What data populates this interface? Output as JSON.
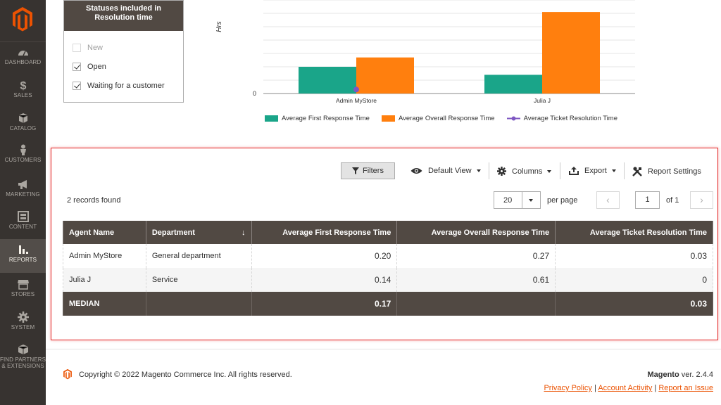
{
  "sidebar": {
    "items": [
      {
        "label": "DASHBOARD",
        "icon": "dashboard-icon"
      },
      {
        "label": "SALES",
        "icon": "dollar-icon"
      },
      {
        "label": "CATALOG",
        "icon": "cube-icon"
      },
      {
        "label": "CUSTOMERS",
        "icon": "person-icon"
      },
      {
        "label": "MARKETING",
        "icon": "megaphone-icon"
      },
      {
        "label": "CONTENT",
        "icon": "content-icon"
      },
      {
        "label": "REPORTS",
        "icon": "bar-chart-icon"
      },
      {
        "label": "STORES",
        "icon": "store-icon"
      },
      {
        "label": "SYSTEM",
        "icon": "gear-icon"
      },
      {
        "label": "FIND PARTNERS",
        "label2": "& EXTENSIONS",
        "icon": "box-icon"
      }
    ]
  },
  "statuses": {
    "title_line1": "Statuses included in",
    "title_line2": "Resolution time",
    "items": [
      {
        "label": "New",
        "checked": false,
        "disabled": true
      },
      {
        "label": "Open",
        "checked": true,
        "disabled": false
      },
      {
        "label": "Waiting for a customer",
        "checked": true,
        "disabled": false
      }
    ]
  },
  "chart_data": {
    "type": "bar",
    "ylabel": "Hrs",
    "ytick_zero": "0",
    "categories": [
      "Admin MyStore",
      "Julia J"
    ],
    "series": [
      {
        "name": "Average First Response Time",
        "color": "#1aa589",
        "values": [
          0.2,
          0.14
        ]
      },
      {
        "name": "Average Overall Response Time",
        "color": "#ff7f0e",
        "values": [
          0.27,
          0.61
        ]
      },
      {
        "name": "Average Ticket Resolution Time",
        "color": "#7e57c2",
        "values": [
          0.03,
          0
        ]
      }
    ],
    "ylim": [
      0,
      0.7
    ]
  },
  "toolbar": {
    "filters": "Filters",
    "view": "Default View",
    "columns": "Columns",
    "export": "Export",
    "settings": "Report Settings"
  },
  "grid": {
    "records_found": "2 records found",
    "per_page_value": "20",
    "per_page_label": "per page",
    "page_value": "1",
    "page_of": "of 1",
    "columns": [
      "Agent Name",
      "Department",
      "Average First Response Time",
      "Average Overall Response Time",
      "Average Ticket Resolution Time"
    ],
    "rows": [
      [
        "Admin MyStore",
        "General department",
        "0.20",
        "0.27",
        "0.03"
      ],
      [
        "Julia J",
        "Service",
        "0.14",
        "0.61",
        "0"
      ]
    ],
    "footer": [
      "MEDIAN",
      "",
      "0.17",
      "",
      "0.03"
    ]
  },
  "footer": {
    "copyright": "Copyright © 2022 Magento Commerce Inc. All rights reserved.",
    "brand": "Magento",
    "version": " ver. 2.4.4",
    "privacy": "Privacy Policy",
    "sep1": " | ",
    "activity": "Account Activity",
    "sep2": " | ",
    "issue": "Report an Issue"
  },
  "colors": {
    "accent": "#eb5202",
    "sidebar_bg": "#373330",
    "header_bg": "#514943"
  }
}
